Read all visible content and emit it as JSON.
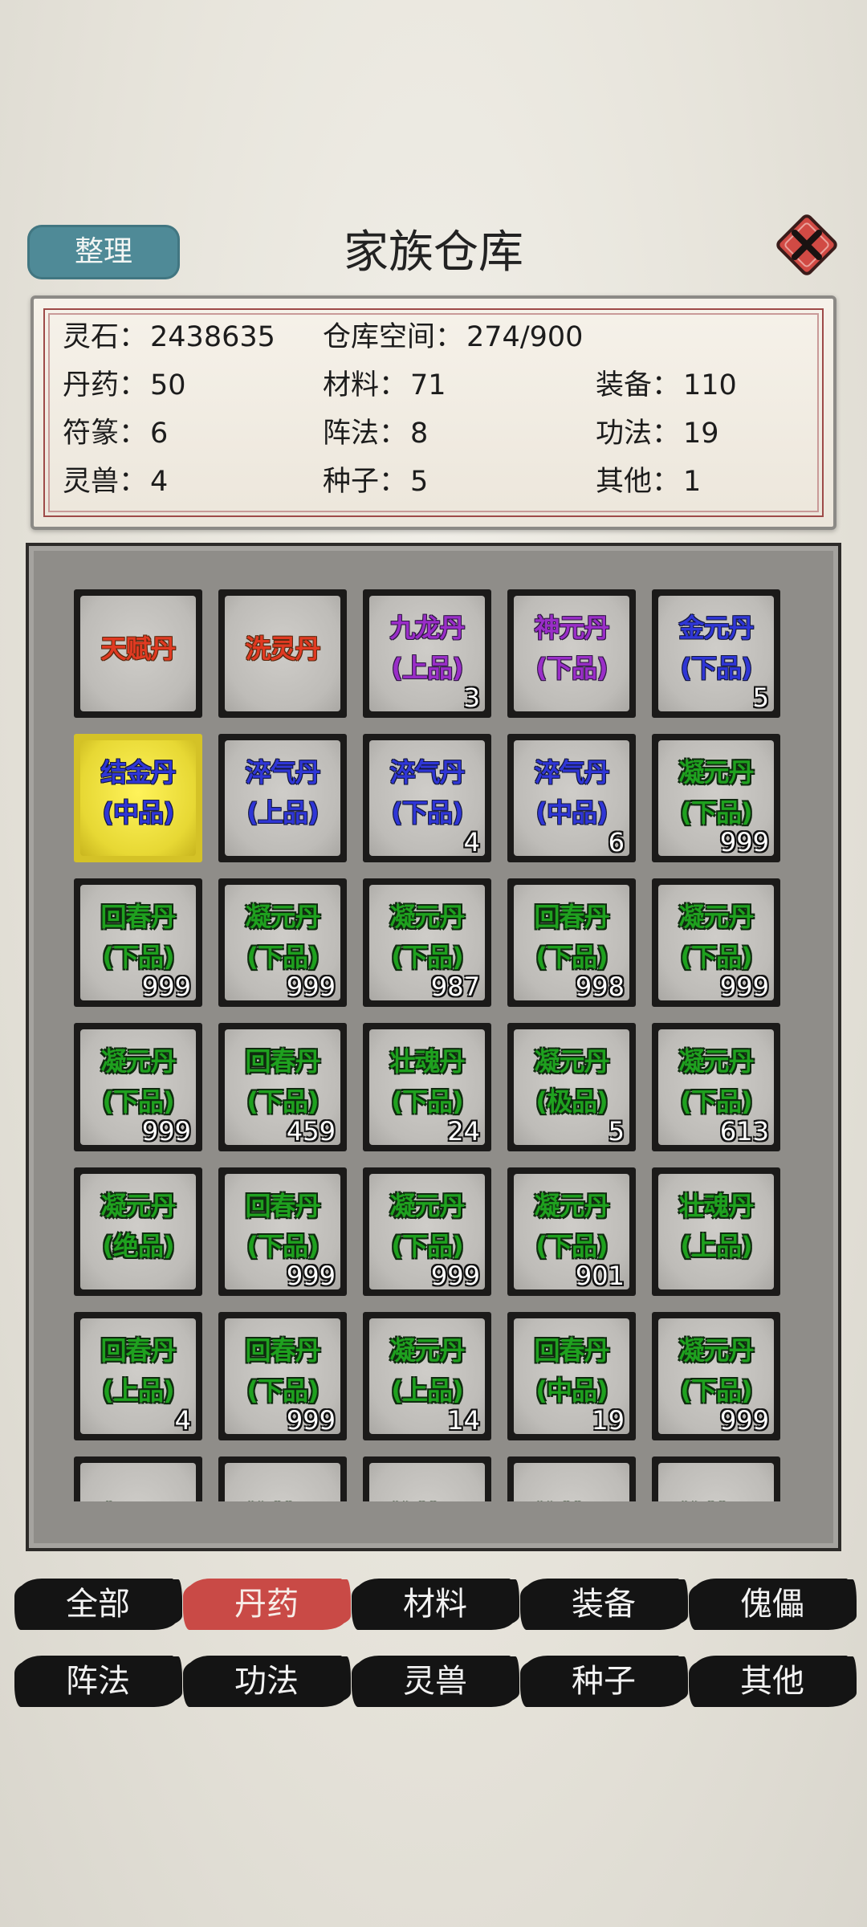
{
  "header": {
    "sort_label": "整理",
    "title": "家族仓库",
    "close_icon": "close-x-icon"
  },
  "stats": {
    "spirit_stone": {
      "label": "灵石：",
      "value": "2438635"
    },
    "space": {
      "label": "仓库空间：",
      "value": "274/900"
    },
    "pills": {
      "label": "丹药：",
      "value": "50"
    },
    "materials": {
      "label": "材料：",
      "value": "71"
    },
    "equipment": {
      "label": "装备：",
      "value": "110"
    },
    "talismans": {
      "label": "符篆：",
      "value": "6"
    },
    "formations": {
      "label": "阵法：",
      "value": "8"
    },
    "techniques": {
      "label": "功法：",
      "value": "19"
    },
    "beasts": {
      "label": "灵兽：",
      "value": "4"
    },
    "seeds": {
      "label": "种子：",
      "value": "5"
    },
    "other": {
      "label": "其他：",
      "value": "1"
    }
  },
  "items": [
    {
      "name": "天赋丹",
      "grade": "",
      "count": "",
      "quality": "red"
    },
    {
      "name": "洗灵丹",
      "grade": "",
      "count": "",
      "quality": "red"
    },
    {
      "name": "九龙丹",
      "grade": "(上品)",
      "count": "3",
      "quality": "purple"
    },
    {
      "name": "神元丹",
      "grade": "(下品)",
      "count": "",
      "quality": "purple"
    },
    {
      "name": "金元丹",
      "grade": "(下品)",
      "count": "5",
      "quality": "blue"
    },
    {
      "name": "结金丹",
      "grade": "(中品)",
      "count": "",
      "quality": "blue",
      "selected": true
    },
    {
      "name": "淬气丹",
      "grade": "(上品)",
      "count": "",
      "quality": "blue"
    },
    {
      "name": "淬气丹",
      "grade": "(下品)",
      "count": "4",
      "quality": "blue"
    },
    {
      "name": "淬气丹",
      "grade": "(中品)",
      "count": "6",
      "quality": "blue"
    },
    {
      "name": "凝元丹",
      "grade": "(下品)",
      "count": "999",
      "quality": "green"
    },
    {
      "name": "回春丹",
      "grade": "(下品)",
      "count": "999",
      "quality": "green"
    },
    {
      "name": "凝元丹",
      "grade": "(下品)",
      "count": "999",
      "quality": "green"
    },
    {
      "name": "凝元丹",
      "grade": "(下品)",
      "count": "987",
      "quality": "green"
    },
    {
      "name": "回春丹",
      "grade": "(下品)",
      "count": "998",
      "quality": "green"
    },
    {
      "name": "凝元丹",
      "grade": "(下品)",
      "count": "999",
      "quality": "green"
    },
    {
      "name": "凝元丹",
      "grade": "(下品)",
      "count": "999",
      "quality": "green"
    },
    {
      "name": "回春丹",
      "grade": "(下品)",
      "count": "459",
      "quality": "green"
    },
    {
      "name": "壮魂丹",
      "grade": "(下品)",
      "count": "24",
      "quality": "green"
    },
    {
      "name": "凝元丹",
      "grade": "(极品)",
      "count": "5",
      "quality": "green"
    },
    {
      "name": "凝元丹",
      "grade": "(下品)",
      "count": "613",
      "quality": "green"
    },
    {
      "name": "凝元丹",
      "grade": "(绝品)",
      "count": "",
      "quality": "green"
    },
    {
      "name": "回春丹",
      "grade": "(下品)",
      "count": "999",
      "quality": "green"
    },
    {
      "name": "凝元丹",
      "grade": "(下品)",
      "count": "999",
      "quality": "green"
    },
    {
      "name": "凝元丹",
      "grade": "(下品)",
      "count": "901",
      "quality": "green"
    },
    {
      "name": "壮魂丹",
      "grade": "(上品)",
      "count": "",
      "quality": "green"
    },
    {
      "name": "回春丹",
      "grade": "(上品)",
      "count": "4",
      "quality": "green"
    },
    {
      "name": "回春丹",
      "grade": "(下品)",
      "count": "999",
      "quality": "green"
    },
    {
      "name": "凝元丹",
      "grade": "(上品)",
      "count": "14",
      "quality": "green"
    },
    {
      "name": "回春丹",
      "grade": "(中品)",
      "count": "19",
      "quality": "green"
    },
    {
      "name": "凝元丹",
      "grade": "(下品)",
      "count": "999",
      "quality": "green"
    },
    {
      "name": "凝元丹",
      "grade": "",
      "count": "",
      "quality": "green"
    },
    {
      "name": "筑基丹",
      "grade": "",
      "count": "",
      "quality": "green"
    },
    {
      "name": "筑基丹",
      "grade": "",
      "count": "",
      "quality": "green"
    },
    {
      "name": "筑基丹",
      "grade": "",
      "count": "",
      "quality": "green"
    },
    {
      "name": "筑基丹",
      "grade": "",
      "count": "",
      "quality": "green"
    }
  ],
  "tabs": [
    {
      "label": "全部",
      "active": false
    },
    {
      "label": "丹药",
      "active": true
    },
    {
      "label": "材料",
      "active": false
    },
    {
      "label": "装备",
      "active": false
    },
    {
      "label": "傀儡",
      "active": false
    },
    {
      "label": "阵法",
      "active": false
    },
    {
      "label": "功法",
      "active": false
    },
    {
      "label": "灵兽",
      "active": false
    },
    {
      "label": "种子",
      "active": false
    },
    {
      "label": "其他",
      "active": false
    }
  ],
  "colors": {
    "red": "#e03a22",
    "purple": "#9a2ec8",
    "blue": "#2f36d6",
    "green": "#1fa11f",
    "active_tab": "#c94a46",
    "sort_button": "#4f8a97"
  }
}
